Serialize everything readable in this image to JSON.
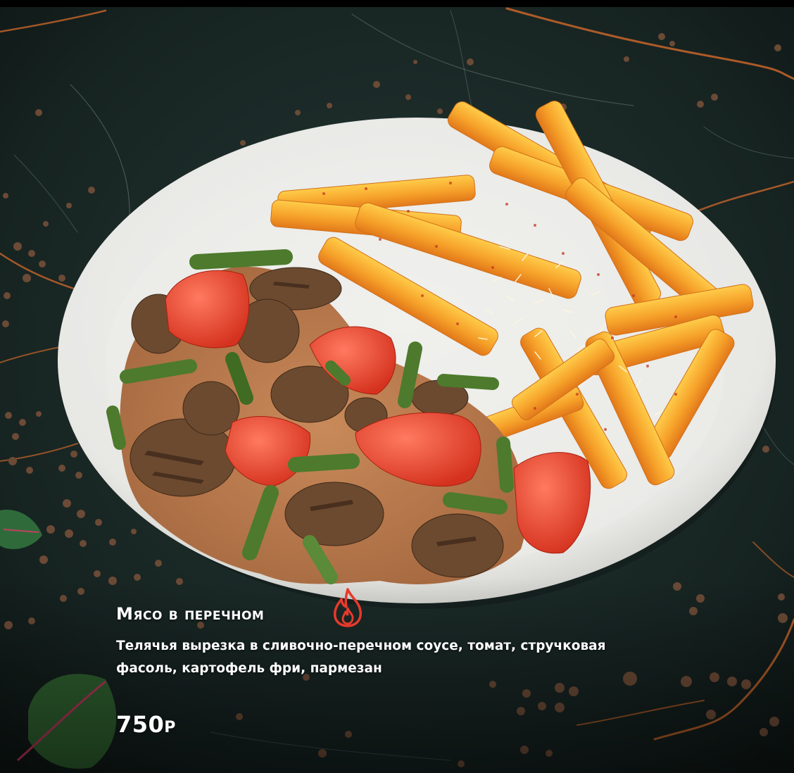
{
  "dish": {
    "title": "Мясо в перечном",
    "description": "Телячья вырезка в сливочно-перечном соусе, томат, стручковая фасоль, картофель фри, пармезан",
    "price_value": "750",
    "price_currency": "Р",
    "spicy_icon": "flame-icon"
  },
  "colors": {
    "background": "#1b2a28",
    "vein": "#d2691e",
    "accent_red": "#e8392b",
    "text": "#ffffff"
  }
}
